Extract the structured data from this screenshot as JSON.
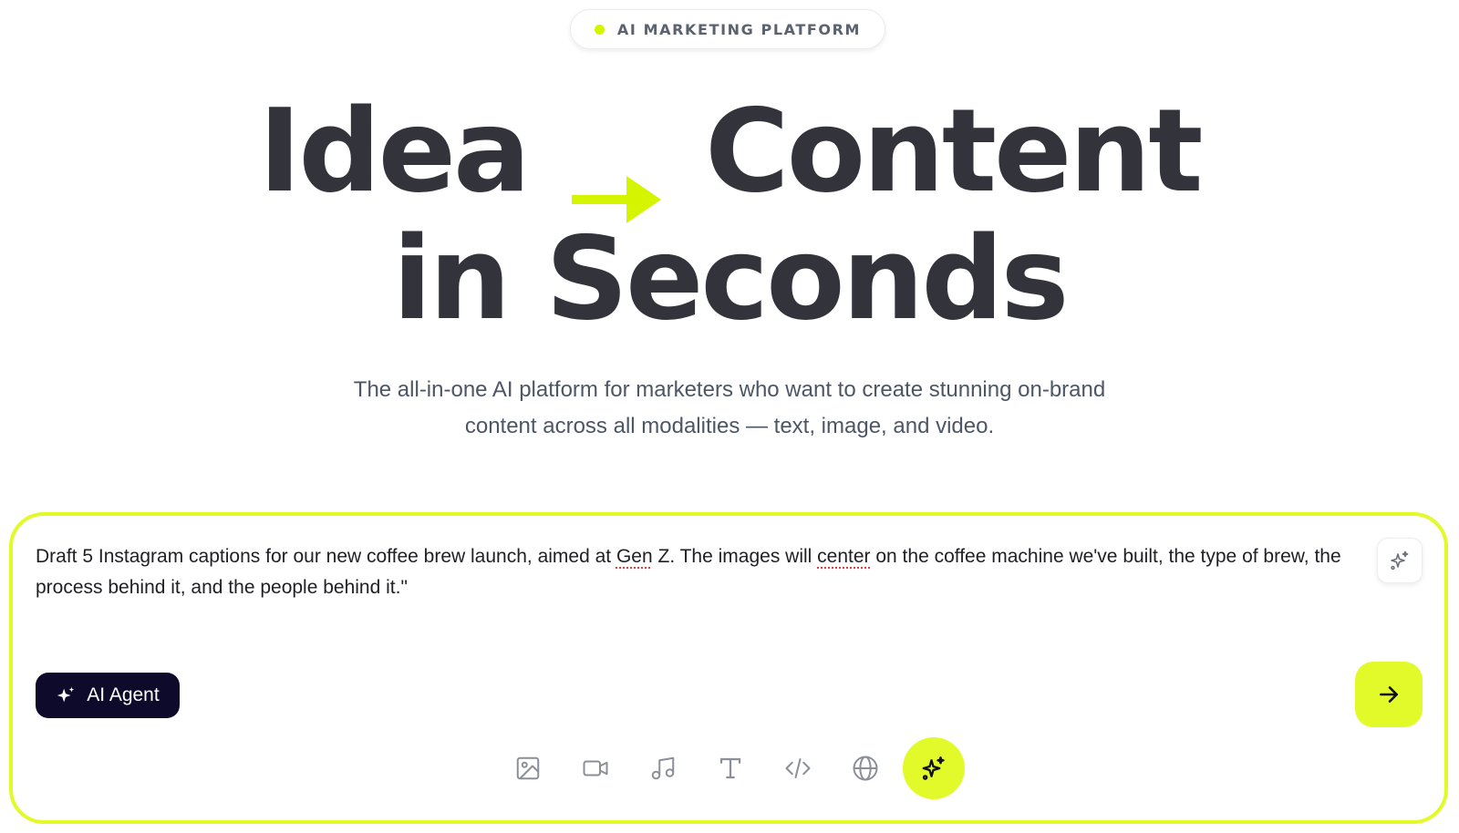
{
  "badge": {
    "label": "AI MARKETING PLATFORM"
  },
  "hero": {
    "headline_word_1": "Idea",
    "headline_word_2": "Content",
    "headline_line_2": "in Seconds",
    "subtitle_line_1": "The all-in-one AI platform for marketers who want to create stunning on-brand",
    "subtitle_line_2": "content across all modalities — text, image, and video."
  },
  "prompt": {
    "text_a": "Draft 5 Instagram captions for our new coffee brew launch, aimed at ",
    "text_b": "Gen",
    "text_c": " Z. The images will ",
    "text_d": "center",
    "text_e": " on the coffee machine we've built, the type of brew, the process behind it, and the people behind it.\""
  },
  "agent_button": {
    "label": "AI Agent"
  },
  "toolbar": {
    "tools": [
      "image-icon",
      "video-icon",
      "music-icon",
      "text-icon",
      "code-icon",
      "globe-icon",
      "sparkle-icon"
    ]
  },
  "colors": {
    "accent": "#e2f92a",
    "dark_button": "#0d0a2c",
    "headline": "#33333b"
  }
}
